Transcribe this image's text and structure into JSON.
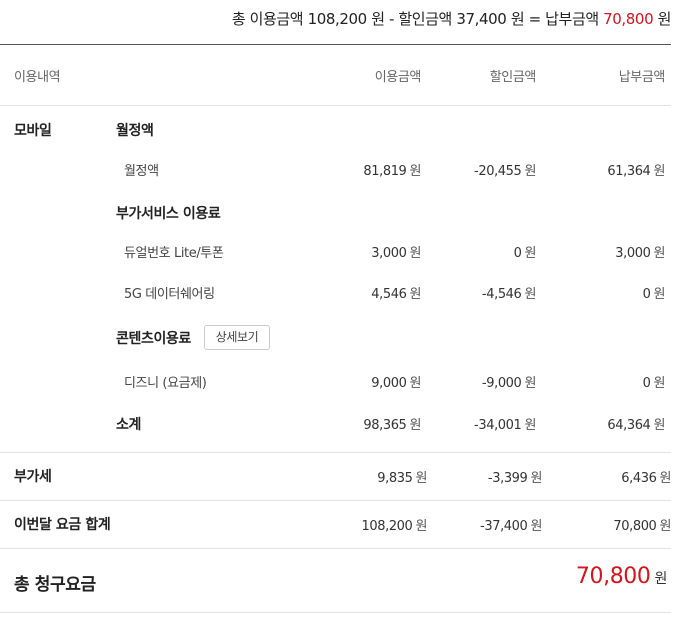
{
  "summary": {
    "total_label": "총 이용금액",
    "total_value": "108,200",
    "won": "원",
    "minus": "-",
    "discount_label": "할인금액",
    "discount_value": "37,400",
    "equals": "=",
    "pay_label": "납부금액",
    "pay_value": "70,800"
  },
  "headers": {
    "detail": "이용내역",
    "usage": "이용금액",
    "discount": "할인금액",
    "payment": "납부금액"
  },
  "unit": "원",
  "mobile": {
    "label": "모바일",
    "monthly": {
      "label": "월정액",
      "item": {
        "name": "월정액",
        "usage": "81,819",
        "discount": "-20,455",
        "payment": "61,364"
      }
    },
    "addon": {
      "label": "부가서비스 이용료",
      "items": [
        {
          "name": "듀얼번호 Lite/투폰",
          "usage": "3,000",
          "discount": "0",
          "payment": "3,000"
        },
        {
          "name": "5G 데이터쉐어링",
          "usage": "4,546",
          "discount": "-4,546",
          "payment": "0"
        }
      ]
    },
    "contents": {
      "label": "콘텐츠이용료",
      "detail_button": "상세보기",
      "item": {
        "name": "디즈니 (요금제)",
        "usage": "9,000",
        "discount": "-9,000",
        "payment": "0"
      }
    },
    "subtotal": {
      "label": "소계",
      "usage": "98,365",
      "discount": "-34,001",
      "payment": "64,364"
    }
  },
  "vat": {
    "label": "부가세",
    "usage": "9,835",
    "discount": "-3,399",
    "payment": "6,436"
  },
  "month_total": {
    "label": "이번달 요금 합계",
    "usage": "108,200",
    "discount": "-37,400",
    "payment": "70,800"
  },
  "grand_total": {
    "label": "총 청구요금",
    "value": "70,800",
    "unit": "원"
  },
  "colors": {
    "accent": "#d7131c"
  }
}
